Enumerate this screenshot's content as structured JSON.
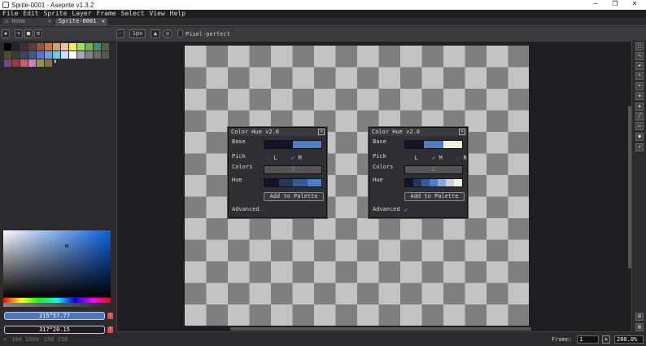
{
  "window": {
    "title": "Sprite-0001 - Aseprite v1.3.2",
    "min": "─",
    "max": "❐",
    "close": "✕"
  },
  "menu": [
    "File",
    "Edit",
    "Sprite",
    "Layer",
    "Frame",
    "Select",
    "View",
    "Help"
  ],
  "tabs": [
    {
      "label": "⌂ Home",
      "close": "✕"
    },
    {
      "label": "Sprite-0001",
      "close": "✕"
    }
  ],
  "toolbar": {
    "brush_size": "1px",
    "pixel_perfect": "Pixel-perfect"
  },
  "palette": [
    "#000000",
    "#222034",
    "#45283c",
    "#663931",
    "#8f563b",
    "#df7126",
    "#d9a066",
    "#eec39a",
    "#fbf236",
    "#99e550",
    "#6abe30",
    "#37946e",
    "#4b692f",
    "#524b24",
    "#323c39",
    "#3f3f74",
    "#306082",
    "#5b6ee1",
    "#639bff",
    "#5fcde4",
    "#cbdbfc",
    "#ffffff",
    "#9badb7",
    "#847e87",
    "#696a6a",
    "#595652",
    "#76428a",
    "#ac3232",
    "#d95763",
    "#d77bba",
    "#8f974a",
    "#8a6f30"
  ],
  "color_fg": {
    "label": "215°57.77",
    "color": "#4a78c0"
  },
  "color_bg": {
    "label": "317°20.15",
    "color": "#221a22"
  },
  "status": {
    "pos": "104 160",
    "size": "256 256",
    "frame_label": "Frame:",
    "frame": "1",
    "zoom": "200.0%"
  },
  "dialogs": [
    {
      "title": "Color Hue v2.0",
      "base_label": "Base",
      "base": [
        "#13132a",
        "#4d7fc8"
      ],
      "pick_label": "Pick",
      "picks": [
        {
          "label": "L",
          "checked": false
        },
        {
          "label": "M",
          "checked": true
        }
      ],
      "colors_label": "Colors",
      "colors": "2",
      "hue_label": "Hue",
      "hue": [
        "#13132a",
        "#26375d",
        "#3a5b92",
        "#4d7fc8"
      ],
      "add": "Add to Palette",
      "advanced_label": "Advanced",
      "advanced": false
    },
    {
      "title": "Color Hue v2.0",
      "base_label": "Base",
      "base": [
        "#13132a",
        "#4d7fc8",
        "#f5f2dc"
      ],
      "pick_label": "Pick",
      "picks": [
        {
          "label": "L",
          "checked": false
        },
        {
          "label": "M",
          "checked": true
        },
        {
          "label": "R",
          "checked": false
        }
      ],
      "colors_label": "Colors",
      "colors": "2",
      "hue_label": "Hue",
      "hue": [
        "#13132a",
        "#26375d",
        "#3a5b92",
        "#4d7fc8",
        "#8aa8d6",
        "#c4d2e0",
        "#f5f2dc"
      ],
      "add": "Add to Palette",
      "advanced_label": "Advanced",
      "advanced": true
    }
  ]
}
